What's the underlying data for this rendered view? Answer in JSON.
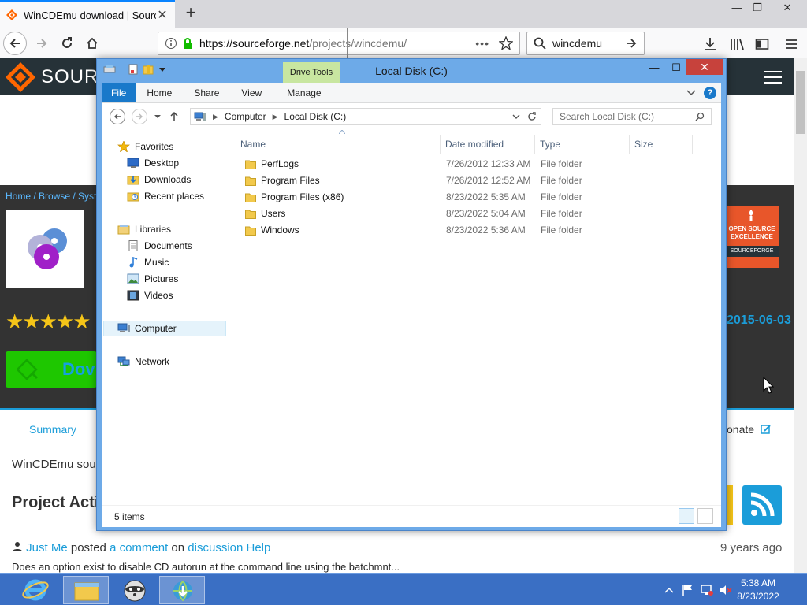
{
  "browser": {
    "tab_title": "WinCDEmu download | SourceForge.net",
    "tab_close": "✕",
    "new_tab": "+",
    "url_host": "https://sourceforge.net",
    "url_path": "/projects/wincdemu/",
    "url_more": "•••",
    "search_value": "wincdemu",
    "window_min": "—",
    "window_restore": "❐",
    "window_close": "✕"
  },
  "page": {
    "logo_text": "SOURC",
    "breadcrumb": "Home / Browse / Syste",
    "stars": "★★★★★",
    "date": "2015-06-03",
    "download_text": "Dov",
    "badge_line1": "OPEN SOURCE",
    "badge_line2": "EXCELLENCE",
    "badge_line3": "SOURCEFORGE",
    "summary_tab": "Summary",
    "donate_tab": "onate",
    "description": "WinCDEmu sou",
    "activity_heading": "Project Acti",
    "comment_user": "Just Me",
    "comment_posted": " posted ",
    "comment_link": "a comment",
    "comment_on": " on ",
    "comment_topic": "discussion Help",
    "comment_ago": "9 years ago",
    "comment_body": "Does an option exist to disable CD autorun at the command line using the batchmnt..."
  },
  "explorer": {
    "title": "Local Disk (C:)",
    "contextual_tab": "Drive Tools",
    "close": "✕",
    "min": "—",
    "max": "☐",
    "ribbon_tabs": [
      "File",
      "Home",
      "Share",
      "View",
      "Manage"
    ],
    "help": "?",
    "address": [
      "Computer",
      "Local Disk (C:)"
    ],
    "search_placeholder": "Search Local Disk (C:)",
    "nav": {
      "favorites": "Favorites",
      "desktop": "Desktop",
      "downloads": "Downloads",
      "recent": "Recent places",
      "libraries": "Libraries",
      "documents": "Documents",
      "music": "Music",
      "pictures": "Pictures",
      "videos": "Videos",
      "computer": "Computer",
      "network": "Network"
    },
    "columns": [
      "Name",
      "Date modified",
      "Type",
      "Size"
    ],
    "rows": [
      {
        "name": "PerfLogs",
        "date": "7/26/2012 12:33 AM",
        "type": "File folder"
      },
      {
        "name": "Program Files",
        "date": "7/26/2012 12:52 AM",
        "type": "File folder"
      },
      {
        "name": "Program Files (x86)",
        "date": "8/23/2022 5:35 AM",
        "type": "File folder"
      },
      {
        "name": "Users",
        "date": "8/23/2022 5:04 AM",
        "type": "File folder"
      },
      {
        "name": "Windows",
        "date": "8/23/2022 5:36 AM",
        "type": "File folder"
      }
    ],
    "status": "5 items"
  },
  "taskbar": {
    "time": "5:38 AM",
    "date": "8/23/2022"
  },
  "colors": {
    "explorer_frame": "#6daae8",
    "file_tab": "#1979ca",
    "drive_tools": "#c8e6a0",
    "close_red": "#c7423c",
    "taskbar": "#3a6fc4",
    "sf_link": "#1b9dd9"
  }
}
